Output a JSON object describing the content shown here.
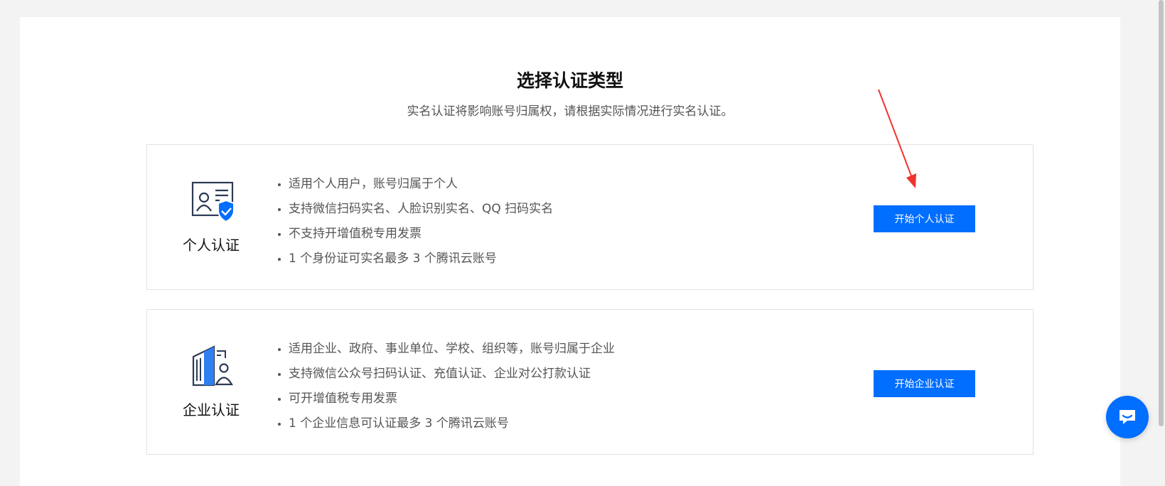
{
  "header": {
    "title": "选择认证类型",
    "subtitle": "实名认证将影响账号归属权，请根据实际情况进行实名认证。"
  },
  "cards": [
    {
      "id": "personal",
      "name": "个人认证",
      "icon": "id-card-shield-icon",
      "features": [
        "适用个人用户，账号归属于个人",
        "支持微信扫码实名、人脸识别实名、QQ 扫码实名",
        "不支持开增值税专用发票",
        "1 个身份证可实名最多 3 个腾讯云账号"
      ],
      "button_label": "开始个人认证"
    },
    {
      "id": "enterprise",
      "name": "企业认证",
      "icon": "building-user-icon",
      "features": [
        "适用企业、政府、事业单位、学校、组织等，账号归属于企业",
        "支持微信公众号扫码认证、充值认证、企业对公打款认证",
        "可开增值税专用发票",
        "1 个企业信息可认证最多 3 个腾讯云账号"
      ],
      "button_label": "开始企业认证"
    }
  ],
  "colors": {
    "accent": "#006eff",
    "annotation": "#f0332d"
  },
  "chat": {
    "icon": "chat-bubble-icon"
  }
}
